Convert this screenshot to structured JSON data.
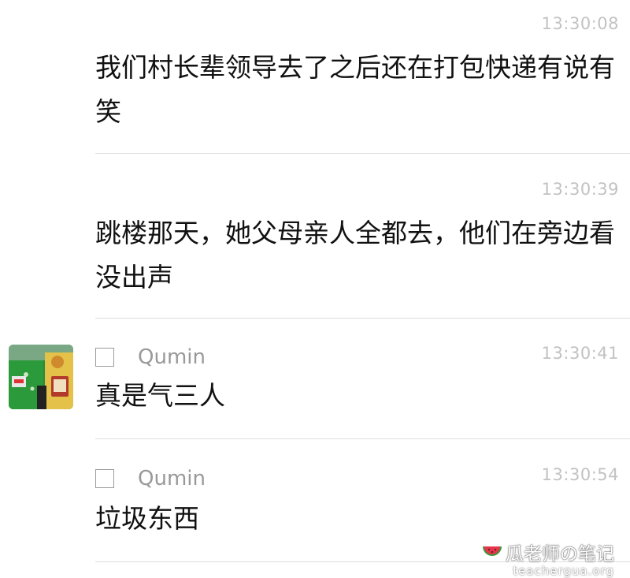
{
  "messages": [
    {
      "time": "13:30:08",
      "text": "我们村长辈领导去了之后还在打包快递有说有笑"
    },
    {
      "time": "13:30:39",
      "text": "跳楼那天，她父母亲人全都去，他们在旁边看没出声"
    },
    {
      "sender": "Qumin",
      "time": "13:30:41",
      "text": "真是气三人"
    },
    {
      "sender": "Qumin",
      "time": "13:30:54",
      "text": "垃圾东西"
    }
  ],
  "watermark": {
    "title": "瓜老师の笔记",
    "url": "teachergua.org",
    "icon": "watermelon-icon"
  },
  "colors": {
    "timestamp": "#c2c2c2",
    "sender": "#999999",
    "divider": "#dedede",
    "avatar_green": "#2e8b3e"
  }
}
